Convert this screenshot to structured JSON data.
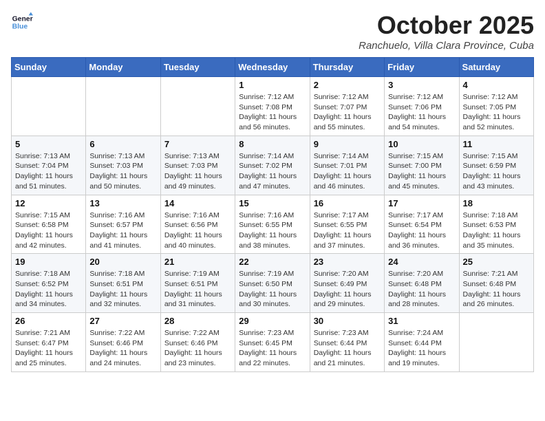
{
  "logo": {
    "line1": "General",
    "line2": "Blue"
  },
  "title": "October 2025",
  "location": "Ranchuelo, Villa Clara Province, Cuba",
  "days_of_week": [
    "Sunday",
    "Monday",
    "Tuesday",
    "Wednesday",
    "Thursday",
    "Friday",
    "Saturday"
  ],
  "weeks": [
    [
      {
        "day": "",
        "info": ""
      },
      {
        "day": "",
        "info": ""
      },
      {
        "day": "",
        "info": ""
      },
      {
        "day": "1",
        "info": "Sunrise: 7:12 AM\nSunset: 7:08 PM\nDaylight: 11 hours and 56 minutes."
      },
      {
        "day": "2",
        "info": "Sunrise: 7:12 AM\nSunset: 7:07 PM\nDaylight: 11 hours and 55 minutes."
      },
      {
        "day": "3",
        "info": "Sunrise: 7:12 AM\nSunset: 7:06 PM\nDaylight: 11 hours and 54 minutes."
      },
      {
        "day": "4",
        "info": "Sunrise: 7:12 AM\nSunset: 7:05 PM\nDaylight: 11 hours and 52 minutes."
      }
    ],
    [
      {
        "day": "5",
        "info": "Sunrise: 7:13 AM\nSunset: 7:04 PM\nDaylight: 11 hours and 51 minutes."
      },
      {
        "day": "6",
        "info": "Sunrise: 7:13 AM\nSunset: 7:03 PM\nDaylight: 11 hours and 50 minutes."
      },
      {
        "day": "7",
        "info": "Sunrise: 7:13 AM\nSunset: 7:03 PM\nDaylight: 11 hours and 49 minutes."
      },
      {
        "day": "8",
        "info": "Sunrise: 7:14 AM\nSunset: 7:02 PM\nDaylight: 11 hours and 47 minutes."
      },
      {
        "day": "9",
        "info": "Sunrise: 7:14 AM\nSunset: 7:01 PM\nDaylight: 11 hours and 46 minutes."
      },
      {
        "day": "10",
        "info": "Sunrise: 7:15 AM\nSunset: 7:00 PM\nDaylight: 11 hours and 45 minutes."
      },
      {
        "day": "11",
        "info": "Sunrise: 7:15 AM\nSunset: 6:59 PM\nDaylight: 11 hours and 43 minutes."
      }
    ],
    [
      {
        "day": "12",
        "info": "Sunrise: 7:15 AM\nSunset: 6:58 PM\nDaylight: 11 hours and 42 minutes."
      },
      {
        "day": "13",
        "info": "Sunrise: 7:16 AM\nSunset: 6:57 PM\nDaylight: 11 hours and 41 minutes."
      },
      {
        "day": "14",
        "info": "Sunrise: 7:16 AM\nSunset: 6:56 PM\nDaylight: 11 hours and 40 minutes."
      },
      {
        "day": "15",
        "info": "Sunrise: 7:16 AM\nSunset: 6:55 PM\nDaylight: 11 hours and 38 minutes."
      },
      {
        "day": "16",
        "info": "Sunrise: 7:17 AM\nSunset: 6:55 PM\nDaylight: 11 hours and 37 minutes."
      },
      {
        "day": "17",
        "info": "Sunrise: 7:17 AM\nSunset: 6:54 PM\nDaylight: 11 hours and 36 minutes."
      },
      {
        "day": "18",
        "info": "Sunrise: 7:18 AM\nSunset: 6:53 PM\nDaylight: 11 hours and 35 minutes."
      }
    ],
    [
      {
        "day": "19",
        "info": "Sunrise: 7:18 AM\nSunset: 6:52 PM\nDaylight: 11 hours and 34 minutes."
      },
      {
        "day": "20",
        "info": "Sunrise: 7:18 AM\nSunset: 6:51 PM\nDaylight: 11 hours and 32 minutes."
      },
      {
        "day": "21",
        "info": "Sunrise: 7:19 AM\nSunset: 6:51 PM\nDaylight: 11 hours and 31 minutes."
      },
      {
        "day": "22",
        "info": "Sunrise: 7:19 AM\nSunset: 6:50 PM\nDaylight: 11 hours and 30 minutes."
      },
      {
        "day": "23",
        "info": "Sunrise: 7:20 AM\nSunset: 6:49 PM\nDaylight: 11 hours and 29 minutes."
      },
      {
        "day": "24",
        "info": "Sunrise: 7:20 AM\nSunset: 6:48 PM\nDaylight: 11 hours and 28 minutes."
      },
      {
        "day": "25",
        "info": "Sunrise: 7:21 AM\nSunset: 6:48 PM\nDaylight: 11 hours and 26 minutes."
      }
    ],
    [
      {
        "day": "26",
        "info": "Sunrise: 7:21 AM\nSunset: 6:47 PM\nDaylight: 11 hours and 25 minutes."
      },
      {
        "day": "27",
        "info": "Sunrise: 7:22 AM\nSunset: 6:46 PM\nDaylight: 11 hours and 24 minutes."
      },
      {
        "day": "28",
        "info": "Sunrise: 7:22 AM\nSunset: 6:46 PM\nDaylight: 11 hours and 23 minutes."
      },
      {
        "day": "29",
        "info": "Sunrise: 7:23 AM\nSunset: 6:45 PM\nDaylight: 11 hours and 22 minutes."
      },
      {
        "day": "30",
        "info": "Sunrise: 7:23 AM\nSunset: 6:44 PM\nDaylight: 11 hours and 21 minutes."
      },
      {
        "day": "31",
        "info": "Sunrise: 7:24 AM\nSunset: 6:44 PM\nDaylight: 11 hours and 19 minutes."
      },
      {
        "day": "",
        "info": ""
      }
    ]
  ]
}
